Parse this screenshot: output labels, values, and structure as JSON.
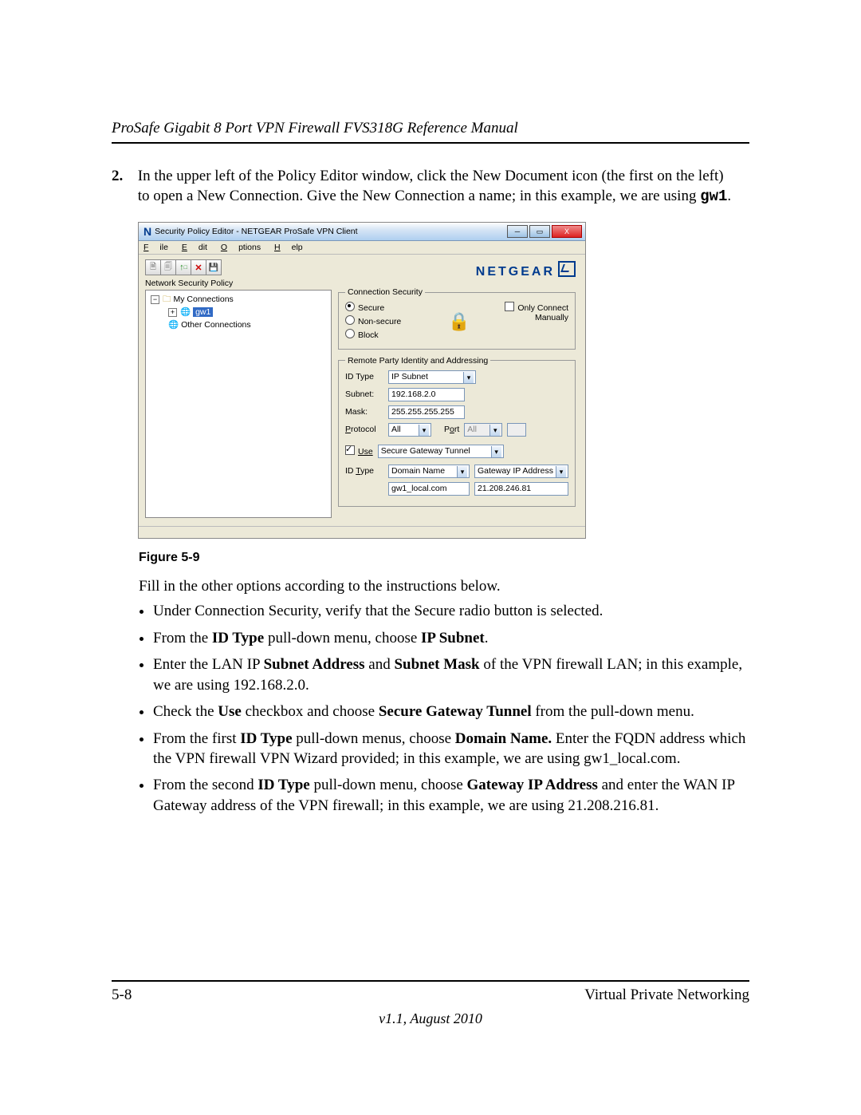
{
  "doc": {
    "header_title": "ProSafe Gigabit 8 Port VPN Firewall FVS318G Reference Manual",
    "step_number": "2.",
    "step_text_part1": "In the upper left of the Policy Editor window, click the New Document icon (the first on the left) to open a New Connection. Give the New Connection a name; in this example, we are using ",
    "step_text_bold": "gw1",
    "step_text_part2": ".",
    "figure_caption": "Figure 5-9",
    "followup_para": "Fill in the other options according to the instructions below.",
    "bullets": [
      {
        "plain": "Under Connection Security, verify that the Secure radio button is selected."
      },
      {
        "pre": "From the ",
        "b1": "ID Type",
        "mid": " pull-down menu, choose ",
        "b2": "IP Subnet",
        "post": "."
      },
      {
        "pre": "Enter the LAN IP ",
        "b1": "Subnet Address",
        "mid": " and ",
        "b2": "Subnet Mask",
        "post": " of the VPN firewall LAN; in this example, we are using 192.168.2.0."
      },
      {
        "pre": "Check the ",
        "b1": "Use",
        "mid": " checkbox and choose ",
        "b2": "Secure Gateway Tunnel",
        "post": " from the pull-down menu."
      },
      {
        "pre": "From the first ",
        "b1": "ID Type",
        "mid": " pull-down menus, choose ",
        "b2": "Domain Name.",
        "post": " Enter the FQDN address which the VPN firewall VPN Wizard provided; in this example, we are using gw1_local.com."
      },
      {
        "pre": "From the second ",
        "b1": "ID Type",
        "mid": " pull-down menu, choose ",
        "b2": "Gateway IP Address",
        "post": " and enter the WAN IP Gateway address of the VPN firewall; in this example, we are using 21.208.216.81."
      }
    ],
    "page_number": "5-8",
    "footer_section": "Virtual Private Networking",
    "version_line": "v1.1, August 2010"
  },
  "app": {
    "window_title": "Security Policy Editor - NETGEAR ProSafe VPN Client",
    "menus": {
      "file": "File",
      "edit": "Edit",
      "options": "Options",
      "help": "Help"
    },
    "tree_label": "Network Security Policy",
    "tree": {
      "root": "My Connections",
      "selected": "gw1",
      "other": "Other Connections"
    },
    "brand": "NETGEAR",
    "conn_security": {
      "legend": "Connection Security",
      "secure": "Secure",
      "nonsecure": "Non-secure",
      "block": "Block",
      "only_connect": "Only Connect Manually"
    },
    "rpia": {
      "legend": "Remote Party Identity and Addressing",
      "id_type_label": "ID Type",
      "id_type_value": "IP Subnet",
      "subnet_label": "Subnet:",
      "subnet_value": "192.168.2.0",
      "mask_label": "Mask:",
      "mask_value": "255.255.255.255",
      "protocol_label": "Protocol",
      "protocol_value": "All",
      "port_label": "Port",
      "port_value": "All",
      "use_label": "Use",
      "use_value": "Secure Gateway Tunnel",
      "id_type2_label": "ID Type",
      "id_type2_value": "Domain Name",
      "gw_select_value": "Gateway IP Address",
      "domain_value": "gw1_local.com",
      "gw_ip_value": "21.208.246.81"
    }
  }
}
